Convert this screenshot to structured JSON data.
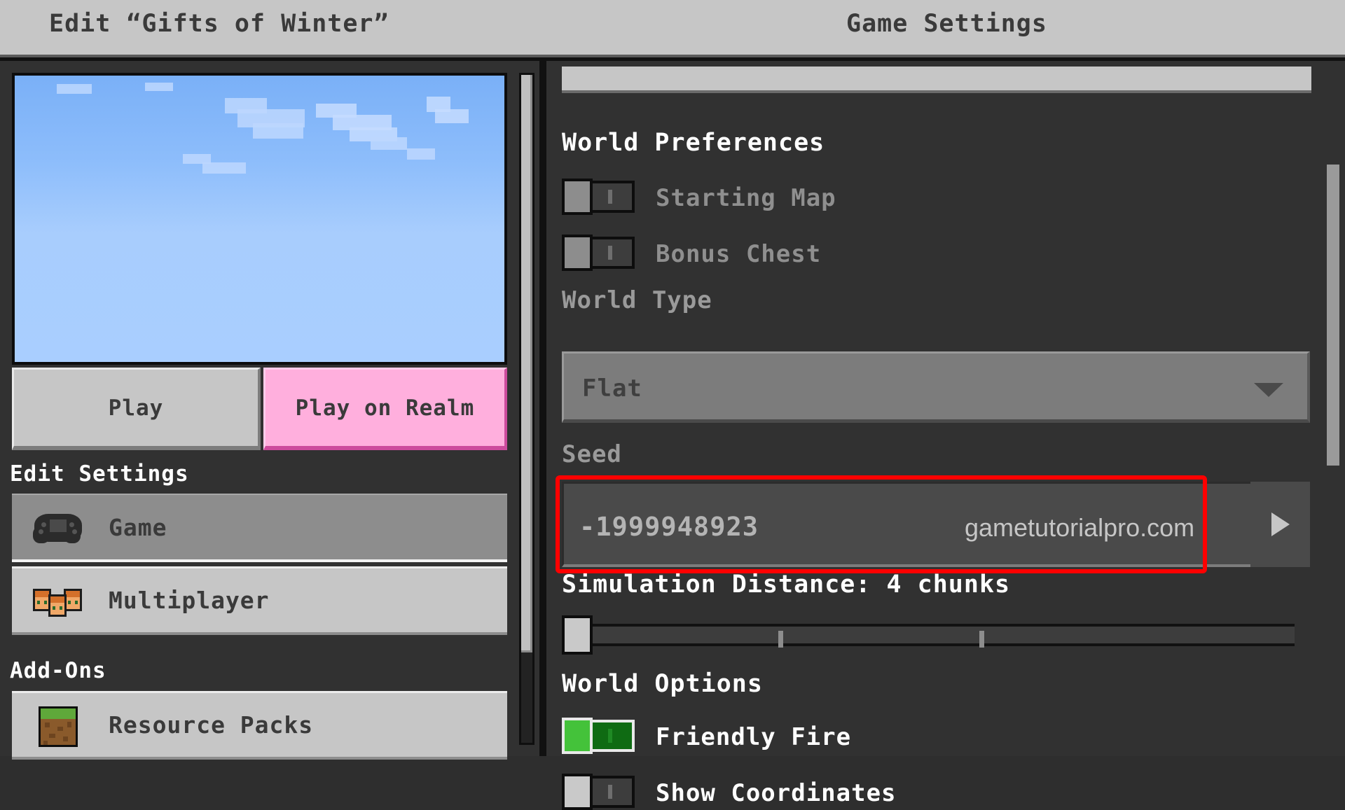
{
  "header": {
    "left_title": "Edit “Gifts of Winter”",
    "right_title": "Game Settings"
  },
  "left_panel": {
    "preview_alt": "world-preview-sky",
    "buttons": {
      "play": "Play",
      "play_on_realm": "Play on Realm"
    },
    "edit_settings_heading": "Edit Settings",
    "nav_items": [
      {
        "label": "Game",
        "icon": "gamepad-icon",
        "selected": true
      },
      {
        "label": "Multiplayer",
        "icon": "players-icon",
        "selected": false
      }
    ],
    "addons_heading": "Add-Ons",
    "addon_items": [
      {
        "label": "Resource Packs",
        "icon": "grass-block-icon"
      }
    ]
  },
  "right_panel": {
    "world_preferences_heading": "World Preferences",
    "world_preferences_toggles": [
      {
        "label": "Starting Map",
        "state": "off",
        "enabled": false
      },
      {
        "label": "Bonus Chest",
        "state": "off",
        "enabled": false
      }
    ],
    "world_type": {
      "label": "World Type",
      "value": "Flat",
      "caret_icon": "chevron-down-icon"
    },
    "seed": {
      "label": "Seed",
      "value": "-1999948923",
      "watermark": "gametutorialpro.com",
      "arrow_icon": "play-arrow-icon",
      "highlight_color": "#ff0000"
    },
    "simulation_distance": {
      "label": "Simulation Distance: 4 chunks",
      "value": 4,
      "min": 4,
      "max": 12,
      "knob_position_pct": 0,
      "ticks_pct": [
        28,
        56
      ]
    },
    "world_options_heading": "World Options",
    "world_options_toggles": [
      {
        "label": "Friendly Fire",
        "state": "on",
        "enabled": true
      },
      {
        "label": "Show Coordinates",
        "state": "off",
        "enabled": true
      }
    ]
  },
  "colors": {
    "header_bg": "#c6c6c6",
    "panel_bg": "#313131",
    "button_gray": "#c6c6c6",
    "realm_pink": "#ffafdd",
    "toggle_on_green": "#44c23a",
    "highlight_red": "#ff0000",
    "selected_row": "#8d8d8d"
  }
}
